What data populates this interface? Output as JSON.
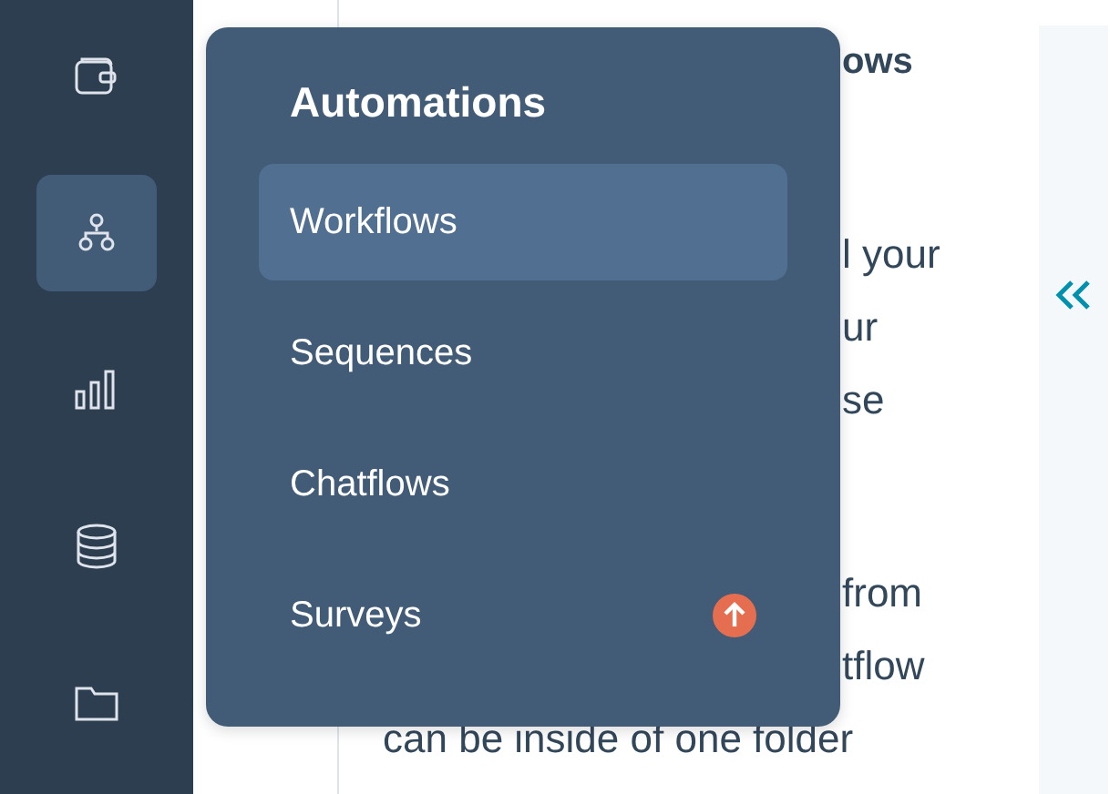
{
  "sidebar": {
    "items": [
      {
        "selected": false
      },
      {
        "selected": true
      },
      {
        "selected": false
      },
      {
        "selected": false
      },
      {
        "selected": false
      }
    ]
  },
  "menu": {
    "title": "Automations",
    "items": [
      {
        "label": "Workflows",
        "selected": true,
        "upgrade": false
      },
      {
        "label": "Sequences",
        "selected": false,
        "upgrade": false
      },
      {
        "label": "Chatflows",
        "selected": false,
        "upgrade": false
      },
      {
        "label": "Surveys",
        "selected": false,
        "upgrade": true
      }
    ]
  },
  "content": {
    "heading": "ows",
    "paragraphs": [
      [
        {
          "text": "l your",
          "kind": "clipped"
        },
        {
          "text": "ur",
          "kind": "clipped"
        },
        {
          "text": "se",
          "kind": "clipped"
        }
      ],
      [
        {
          "text": "from",
          "kind": "clipped"
        },
        {
          "text": "tflow",
          "kind": "clipped"
        },
        {
          "text": "can be inside of one folder",
          "kind": "full"
        }
      ]
    ]
  }
}
